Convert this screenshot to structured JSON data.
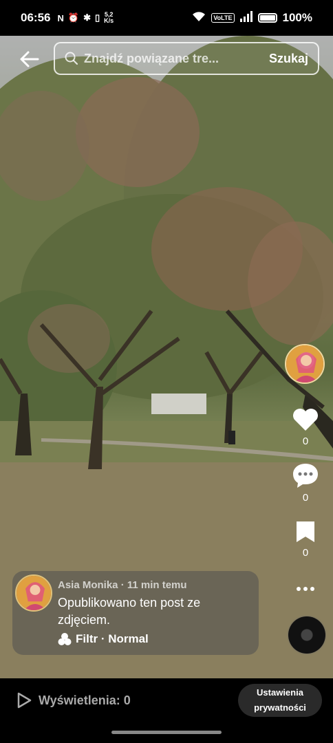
{
  "status_bar": {
    "time": "06:56",
    "net_speed": "5,2\nK/s",
    "volte": "VoLTE",
    "battery": "100%"
  },
  "search": {
    "placeholder": "Znajdź powiązane tre...",
    "button": "Szukaj"
  },
  "actions": {
    "likes": "0",
    "comments": "0",
    "saves": "0"
  },
  "post": {
    "author": "Asia Monika",
    "time": "11 min temu",
    "meta": "Asia Monika · 11 min temu",
    "caption": "Opublikowano ten post ze zdjęciem.",
    "filter": "Filtr · Normal"
  },
  "bottom": {
    "views": "Wyświetlenia: 0",
    "privacy_line1": "Ustawienia",
    "privacy_line2": "prywatności"
  }
}
